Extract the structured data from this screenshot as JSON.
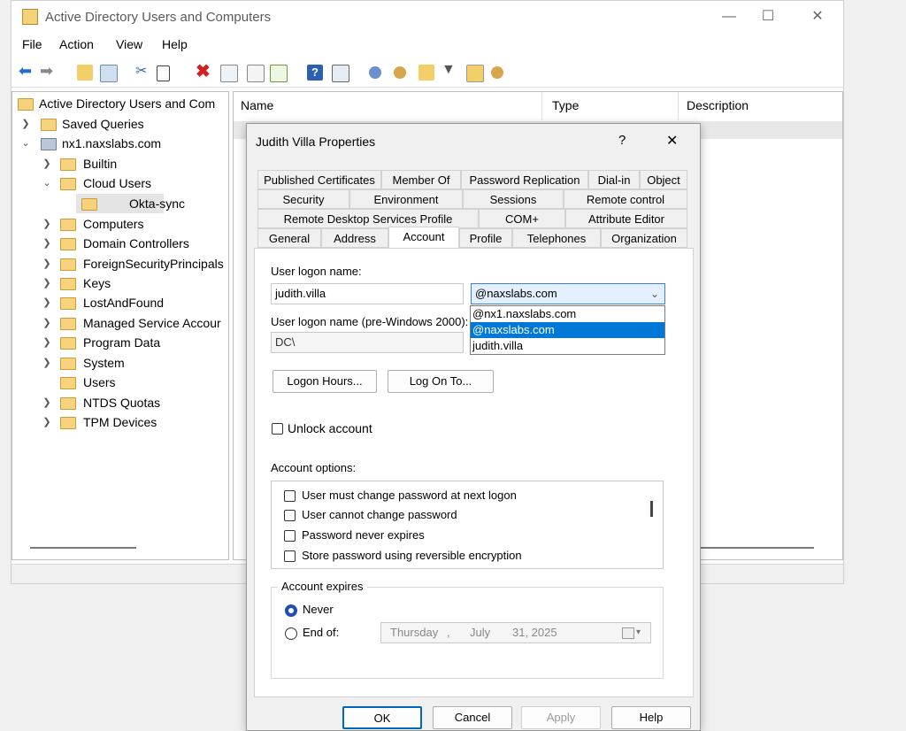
{
  "window": {
    "title": "Active Directory Users and Computers",
    "controls": {
      "minimize": "—",
      "maximize": "☐",
      "close": "✕"
    }
  },
  "menu": [
    "File",
    "Action",
    "View",
    "Help"
  ],
  "toolbar_icons": [
    "back-arrow-icon",
    "forward-arrow-icon",
    "up-folder-icon",
    "show-tree-icon",
    "cut-icon",
    "copy-icon",
    "delete-icon",
    "properties-icon",
    "refresh-icon",
    "export-icon",
    "help-icon",
    "console-icon",
    "new-user-icon",
    "new-group-icon",
    "new-ou-icon",
    "filter-icon",
    "find-icon",
    "add-to-group-icon"
  ],
  "tree": {
    "root": "Active Directory Users and Com",
    "saved_queries": "Saved Queries",
    "domain": "nx1.naxslabs.com",
    "items": [
      {
        "label": "Builtin"
      },
      {
        "label": "Cloud Users"
      },
      {
        "label": "Okta-sync"
      },
      {
        "label": "Computers"
      },
      {
        "label": "Domain Controllers"
      },
      {
        "label": "ForeignSecurityPrincipals"
      },
      {
        "label": "Keys"
      },
      {
        "label": "LostAndFound"
      },
      {
        "label": "Managed Service Accour"
      },
      {
        "label": "Program Data"
      },
      {
        "label": "System"
      },
      {
        "label": "Users"
      },
      {
        "label": "NTDS Quotas"
      },
      {
        "label": "TPM Devices"
      }
    ]
  },
  "list": {
    "columns": [
      "Name",
      "Type",
      "Description"
    ]
  },
  "dialog": {
    "title": "Judith Villa Properties",
    "help_glyph": "?",
    "close_glyph": "✕",
    "tabs_row1": [
      "Published Certificates",
      "Member Of",
      "Password Replication",
      "Dial-in",
      "Object"
    ],
    "tabs_row2": [
      "Security",
      "Environment",
      "Sessions",
      "Remote control"
    ],
    "tabs_row3": [
      "Remote Desktop Services Profile",
      "COM+",
      "Attribute Editor"
    ],
    "tabs_row4": [
      "General",
      "Address",
      "Account",
      "Profile",
      "Telephones",
      "Organization"
    ],
    "active_tab": "Account",
    "account": {
      "logon_name_label": "User logon name:",
      "logon_name_value": "judith.villa",
      "upn_suffix_selected": "@naxslabs.com",
      "upn_suffix_options": [
        "@nx1.naxslabs.com",
        "@naxslabs.com",
        "judith.villa"
      ],
      "pre2000_label": "User logon name (pre-Windows 2000):",
      "pre2000_domain": "DC\\",
      "logon_hours_button": "Logon Hours...",
      "logon_to_button": "Log On To...",
      "unlock_label": "Unlock account",
      "account_options_label": "Account options:",
      "account_options": [
        "User must change password at next logon",
        "User cannot change password",
        "Password never expires",
        "Store password using reversible encryption"
      ],
      "expires_label": "Account expires",
      "never_label": "Never",
      "endof_label": "End of:",
      "date_weekday": "Thursday",
      "date_sep": ",",
      "date_month": "July",
      "date_day_year": "31, 2025"
    },
    "buttons": {
      "ok": "OK",
      "cancel": "Cancel",
      "apply": "Apply",
      "help": "Help"
    }
  },
  "colors": {
    "accent": "#0078d7",
    "folder": "#f6d37c",
    "selection": "#0078d7"
  }
}
